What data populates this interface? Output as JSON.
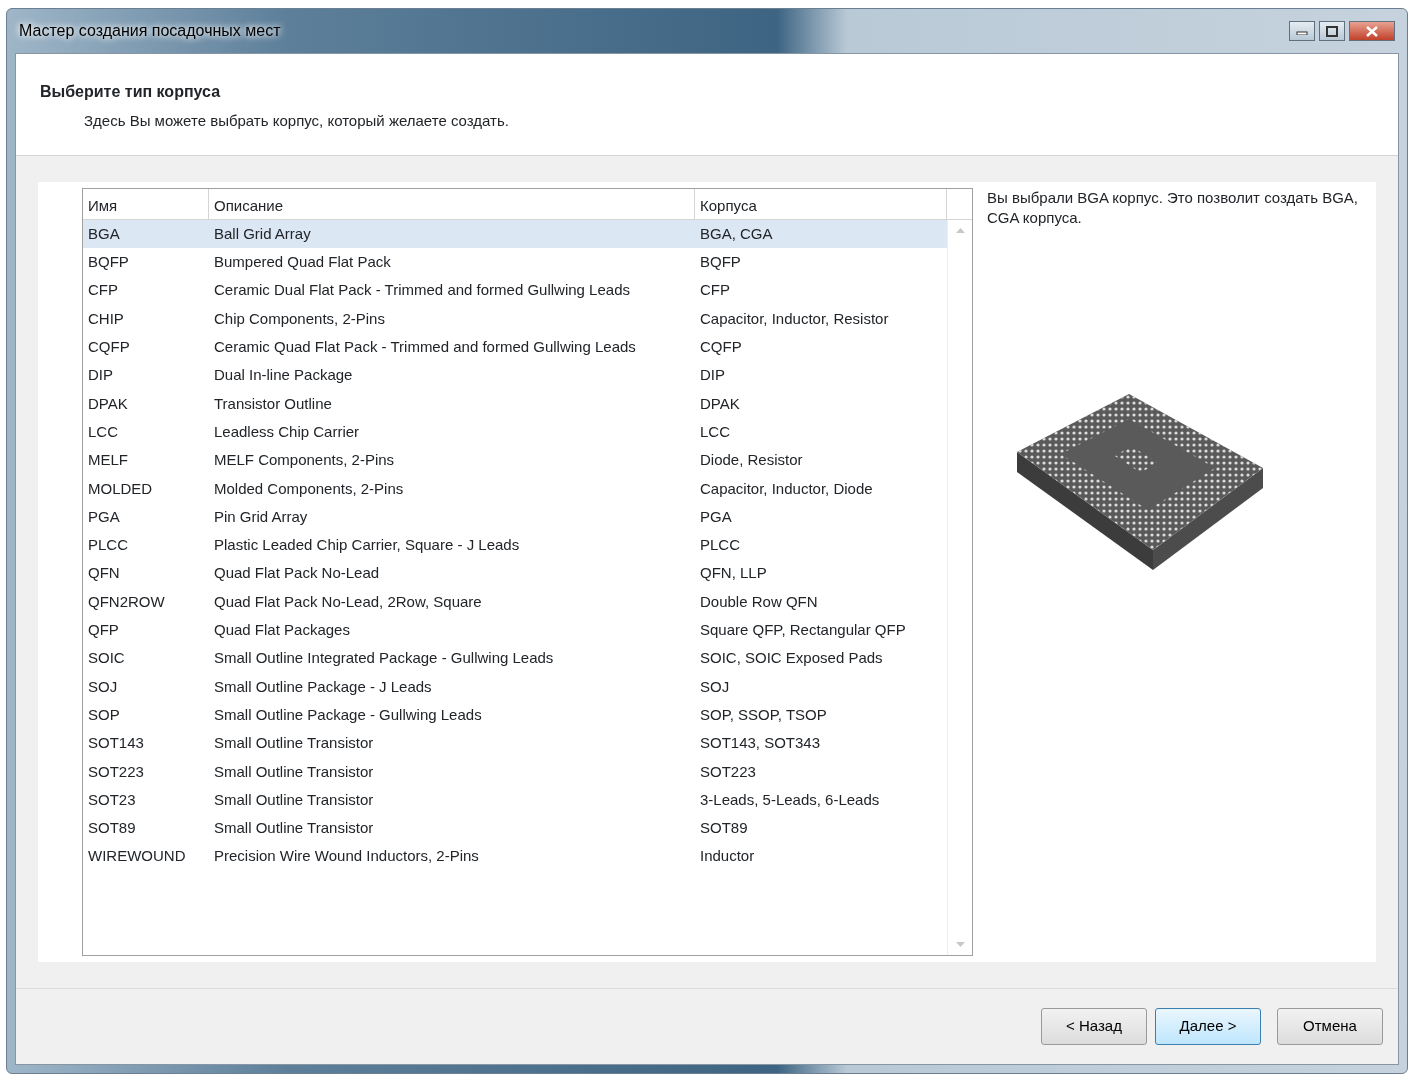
{
  "window": {
    "title": "Мастер создания посадочных мест"
  },
  "header": {
    "title": "Выберите тип корпуса",
    "subtitle": "Здесь Вы можете выбрать корпус, который желаете создать."
  },
  "table": {
    "columns": [
      "Имя",
      "Описание",
      "Корпуса"
    ],
    "rows": [
      {
        "name": "BGA",
        "description": "Ball Grid Array",
        "packages": "BGA, CGA",
        "selected": true
      },
      {
        "name": "BQFP",
        "description": "Bumpered Quad Flat Pack",
        "packages": "BQFP",
        "selected": false
      },
      {
        "name": "CFP",
        "description": "Ceramic Dual Flat Pack - Trimmed and formed Gullwing Leads",
        "packages": "CFP",
        "selected": false
      },
      {
        "name": "CHIP",
        "description": "Chip Components, 2-Pins",
        "packages": "Capacitor, Inductor, Resistor",
        "selected": false
      },
      {
        "name": "CQFP",
        "description": "Ceramic Quad Flat Pack - Trimmed and formed Gullwing Leads",
        "packages": "CQFP",
        "selected": false
      },
      {
        "name": "DIP",
        "description": "Dual In-line Package",
        "packages": "DIP",
        "selected": false
      },
      {
        "name": "DPAK",
        "description": "Transistor Outline",
        "packages": "DPAK",
        "selected": false
      },
      {
        "name": "LCC",
        "description": "Leadless Chip Carrier",
        "packages": "LCC",
        "selected": false
      },
      {
        "name": "MELF",
        "description": "MELF Components, 2-Pins",
        "packages": "Diode, Resistor",
        "selected": false
      },
      {
        "name": "MOLDED",
        "description": "Molded Components, 2-Pins",
        "packages": "Capacitor, Inductor, Diode",
        "selected": false
      },
      {
        "name": "PGA",
        "description": "Pin Grid Array",
        "packages": "PGA",
        "selected": false
      },
      {
        "name": "PLCC",
        "description": "Plastic Leaded Chip Carrier, Square - J Leads",
        "packages": "PLCC",
        "selected": false
      },
      {
        "name": "QFN",
        "description": "Quad Flat Pack No-Lead",
        "packages": "QFN, LLP",
        "selected": false
      },
      {
        "name": "QFN2ROW",
        "description": "Quad Flat Pack No-Lead, 2Row, Square",
        "packages": "Double Row QFN",
        "selected": false
      },
      {
        "name": "QFP",
        "description": "Quad Flat Packages",
        "packages": "Square QFP, Rectangular QFP",
        "selected": false
      },
      {
        "name": "SOIC",
        "description": "Small Outline Integrated Package - Gullwing Leads",
        "packages": "SOIC, SOIC Exposed Pads",
        "selected": false
      },
      {
        "name": "SOJ",
        "description": "Small Outline Package - J Leads",
        "packages": "SOJ",
        "selected": false
      },
      {
        "name": "SOP",
        "description": "Small Outline Package - Gullwing Leads",
        "packages": "SOP, SSOP, TSOP",
        "selected": false
      },
      {
        "name": "SOT143",
        "description": "Small Outline Transistor",
        "packages": "SOT143, SOT343",
        "selected": false
      },
      {
        "name": "SOT223",
        "description": "Small Outline Transistor",
        "packages": "SOT223",
        "selected": false
      },
      {
        "name": "SOT23",
        "description": "Small Outline Transistor",
        "packages": "3-Leads, 5-Leads, 6-Leads",
        "selected": false
      },
      {
        "name": "SOT89",
        "description": "Small Outline Transistor",
        "packages": "SOT89",
        "selected": false
      },
      {
        "name": "WIREWOUND",
        "description": "Precision Wire Wound Inductors, 2-Pins",
        "packages": "Inductor",
        "selected": false
      }
    ]
  },
  "preview": {
    "text": "Вы выбрали BGA корпус. Это позволит создать BGA, CGA корпуса."
  },
  "buttons": [
    {
      "label": "< Назад",
      "kind": "normal"
    },
    {
      "label": "Далее >",
      "kind": "default"
    },
    {
      "label": "Отмена",
      "kind": "normal"
    }
  ]
}
